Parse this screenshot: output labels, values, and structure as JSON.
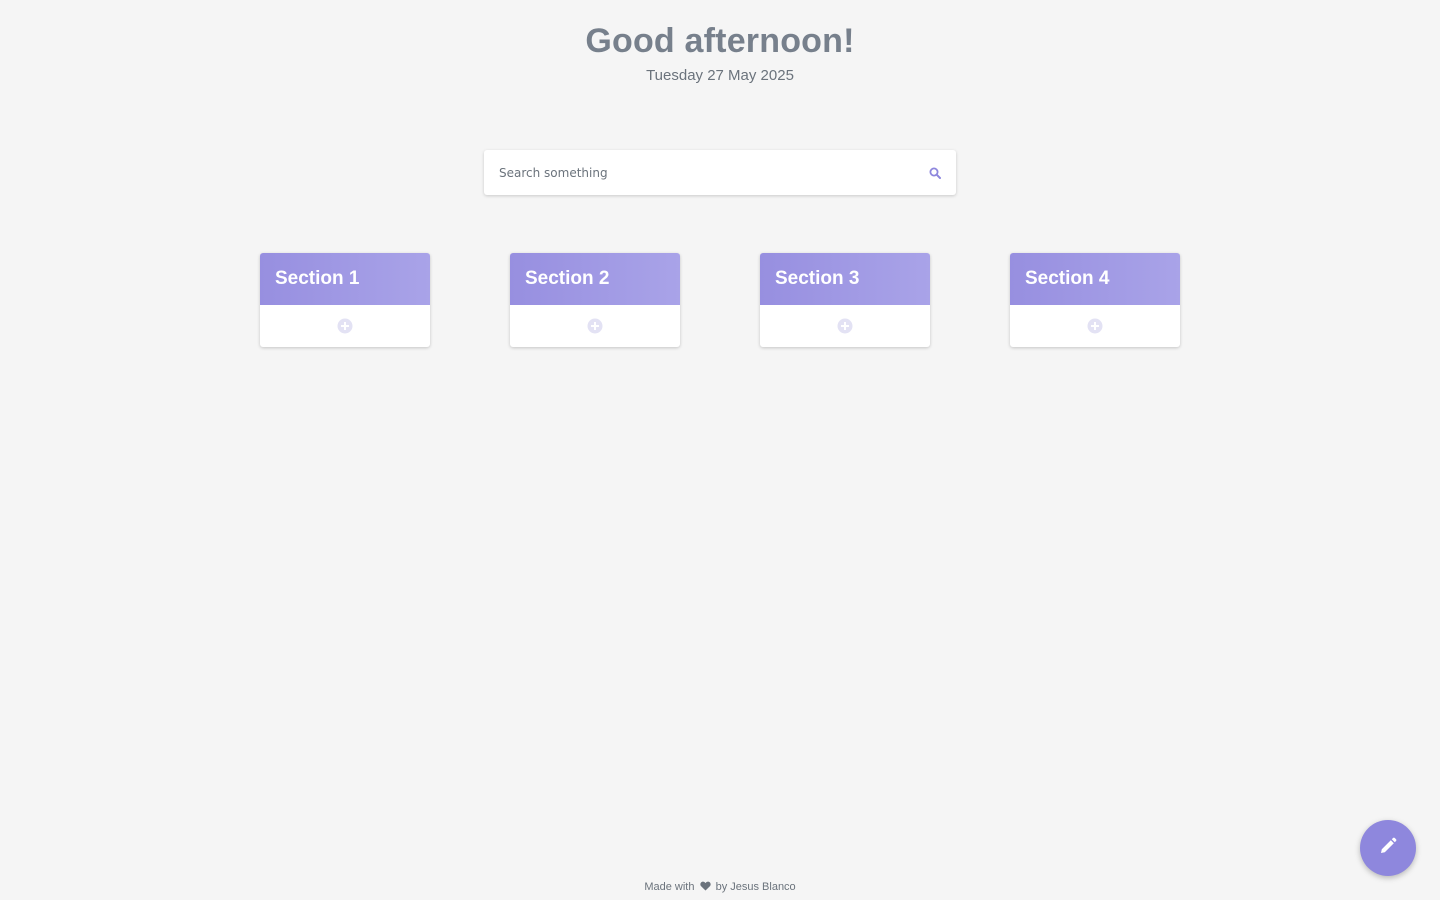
{
  "header": {
    "greeting": "Good afternoon!",
    "date": "Tuesday 27 May 2025"
  },
  "search": {
    "placeholder": "Search something",
    "value": "",
    "icon": "search-icon"
  },
  "sections": [
    {
      "title": "Section 1",
      "add_icon": "plus-circle-icon"
    },
    {
      "title": "Section 2",
      "add_icon": "plus-circle-icon"
    },
    {
      "title": "Section 3",
      "add_icon": "plus-circle-icon"
    },
    {
      "title": "Section 4",
      "add_icon": "plus-circle-icon"
    }
  ],
  "footer": {
    "prefix": "Made with",
    "suffix": "by Jesus Blanco",
    "icon": "heart-icon"
  },
  "fab": {
    "icon": "pencil-icon"
  },
  "colors": {
    "accent": "#8e87dd",
    "header_gradient_start": "#978fe0",
    "header_gradient_end": "#a9a3e8",
    "background": "#f5f5f5",
    "text": "#77808c"
  }
}
